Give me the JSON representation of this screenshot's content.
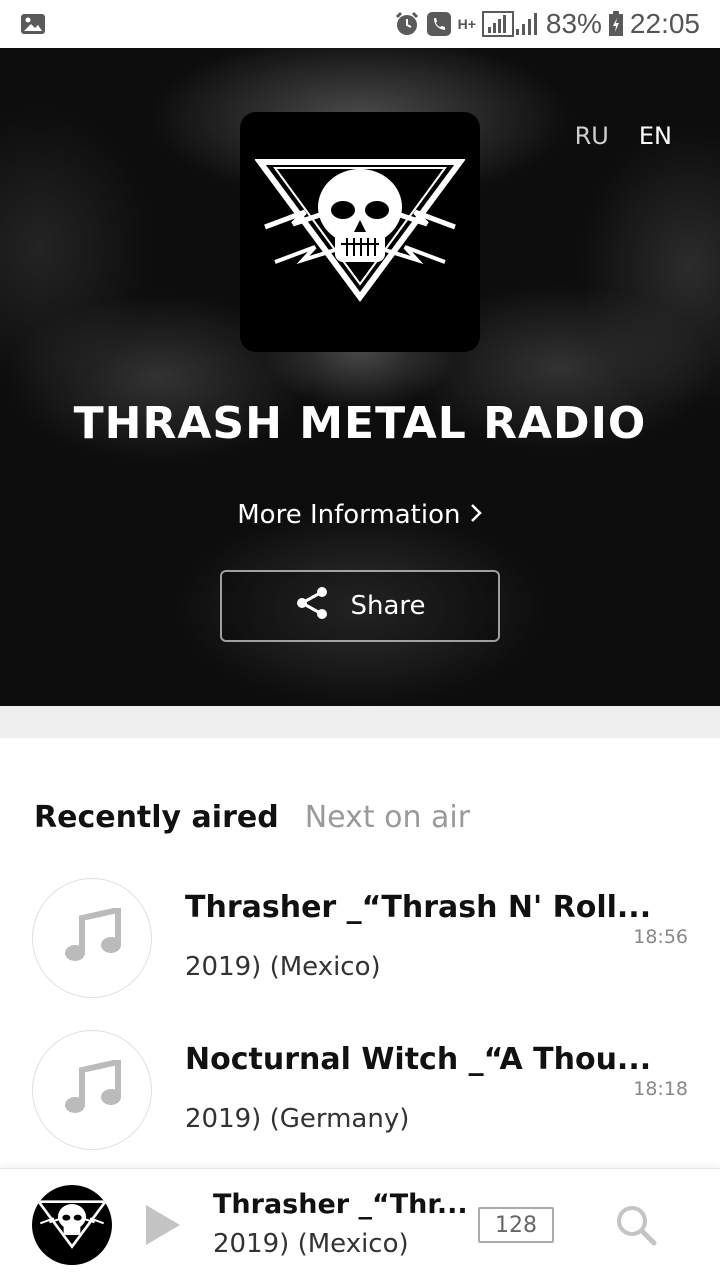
{
  "status_bar": {
    "battery": "83%",
    "time": "22:05",
    "network_label": "H+"
  },
  "hero": {
    "languages": [
      "RU",
      "EN"
    ],
    "station_name": "THRASH METAL RADIO",
    "more_info_label": "More Information",
    "share_label": "Share"
  },
  "tabs": [
    {
      "label": "Recently aired",
      "active": true
    },
    {
      "label": "Next on air",
      "active": false
    }
  ],
  "tracks": [
    {
      "title": "Thrasher _“Thrash N' Roll...",
      "subtitle": "2019) (Mexico)",
      "time": "18:56"
    },
    {
      "title": "Nocturnal Witch _“A Thou...",
      "subtitle": "2019) (Germany)",
      "time": "18:18"
    }
  ],
  "player": {
    "title": "Thrasher _“Thr...",
    "subtitle": "2019) (Mexico)",
    "bitrate": "128"
  },
  "icons": {
    "gallery": "image-icon",
    "alarm": "alarm-icon",
    "call": "phone-icon",
    "share": "share-icon",
    "chevron": "chevron-right-icon",
    "music": "music-note-icon",
    "play": "play-icon",
    "search": "search-icon"
  },
  "colors": {
    "hero_bg": "#0d0d0d",
    "accent_text": "#111111",
    "muted_text": "#9a9a9a",
    "band": "#efefef"
  }
}
